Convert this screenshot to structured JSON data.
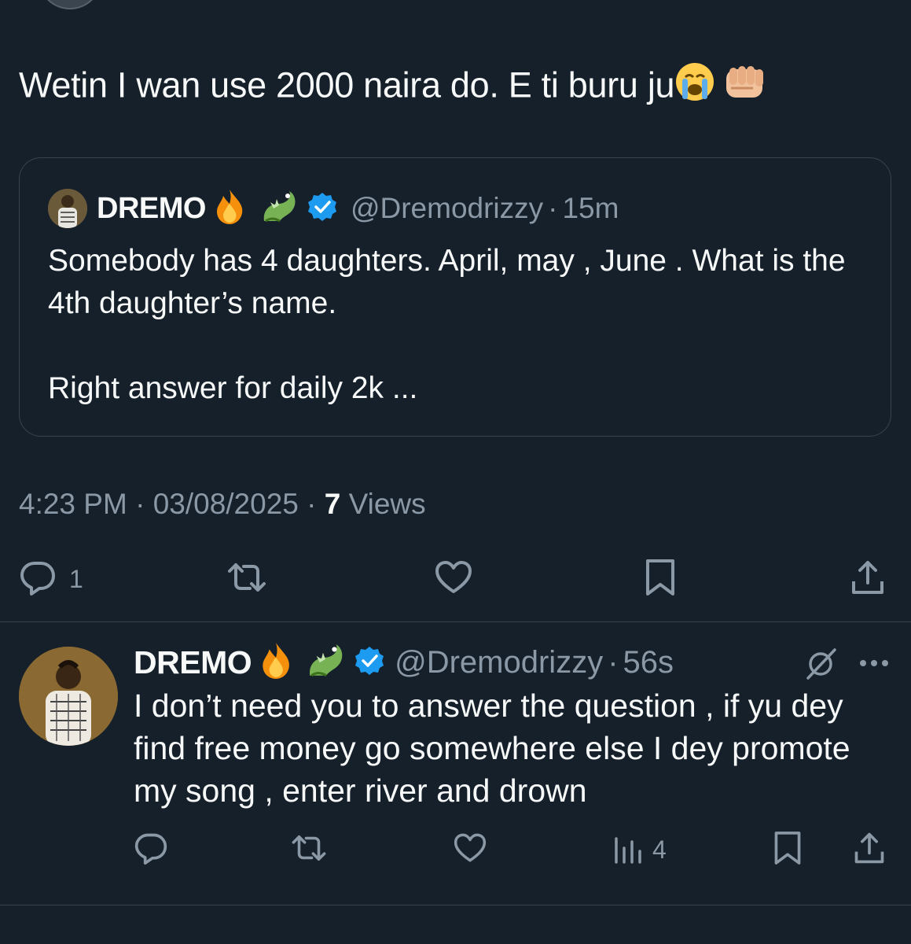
{
  "tweet": {
    "text": "Wetin I wan use 2000 naira do. E ti buru ju",
    "emojis": [
      "loudly-crying-face",
      "oncoming-fist"
    ],
    "quote": {
      "name": "DREMO",
      "name_emojis": [
        "fire",
        "dragon"
      ],
      "verified": true,
      "handle": "@Dremodrizzy",
      "separator": "·",
      "time": "15m",
      "body_lines": [
        "Somebody has 4 daughters. April, may , June . What is the 4th daughter’s name.",
        "Right answer for daily 2k ..."
      ]
    },
    "meta": {
      "time": "4:23 PM",
      "sep1": "·",
      "date": "03/08/2025",
      "sep2": "·",
      "views_count": "7",
      "views_label": "Views"
    },
    "actions": {
      "reply_count": "1",
      "icons": [
        "reply-icon",
        "retweet-icon",
        "like-icon",
        "bookmark-icon",
        "share-icon"
      ]
    }
  },
  "reply": {
    "name": "DREMO",
    "name_emojis": [
      "fire",
      "dragon"
    ],
    "verified": true,
    "handle": "@Dremodrizzy",
    "separator": "·",
    "time": "56s",
    "text": "I don’t need you to answer the question , if yu dey find free money go somewhere else I dey promote my song , enter river and drown",
    "actions": {
      "views_count": "4",
      "icons": [
        "reply-icon",
        "retweet-icon",
        "like-icon",
        "views-icon",
        "bookmark-icon",
        "share-icon"
      ]
    }
  },
  "colors": {
    "background": "#15202b",
    "text": "#f7f9f9",
    "muted": "#8b98a5",
    "border": "#38444d",
    "verified": "#1d9bf0"
  }
}
